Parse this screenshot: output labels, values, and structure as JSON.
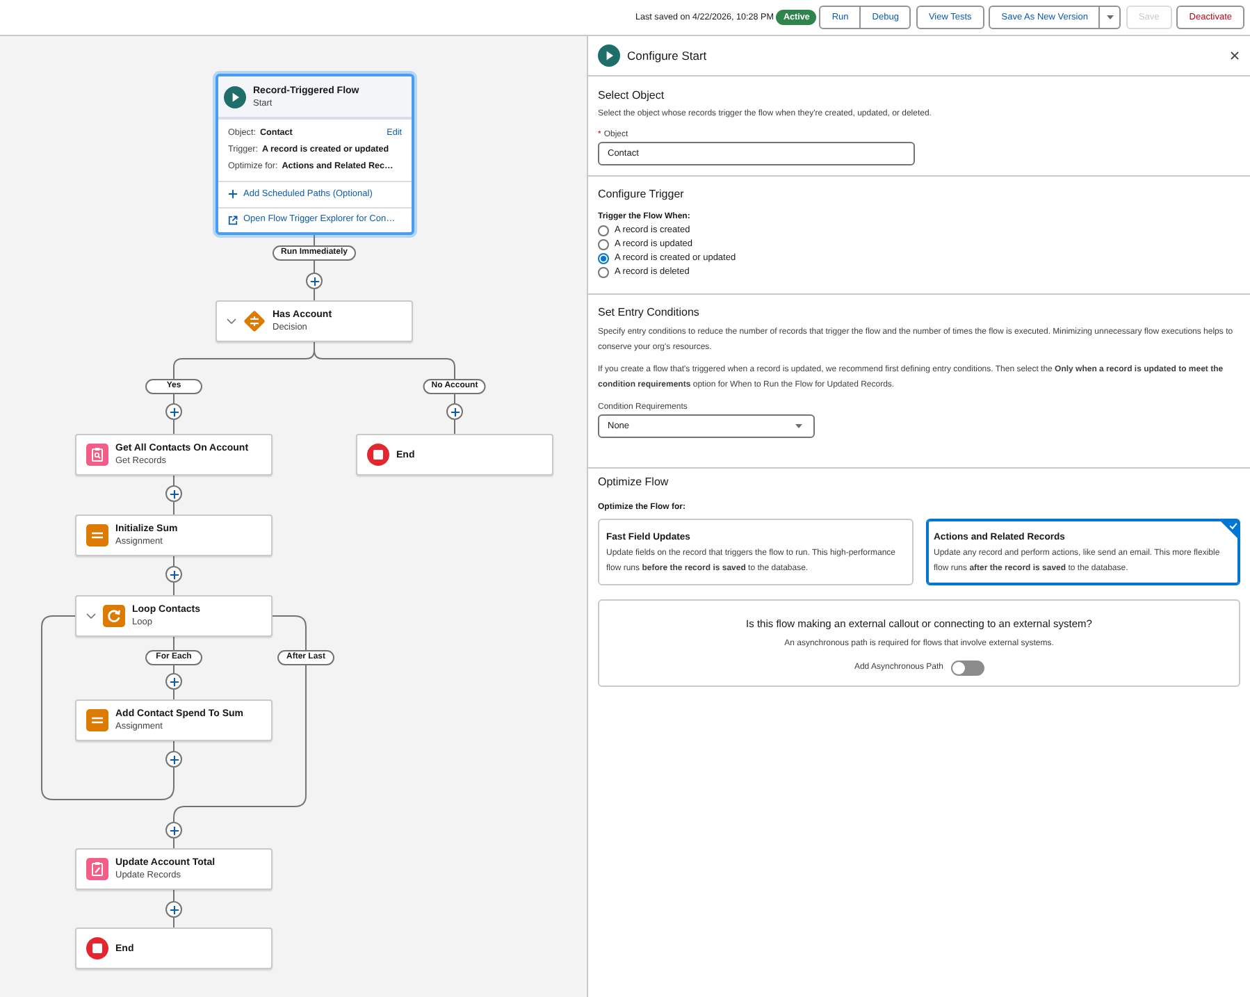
{
  "toolbar": {
    "last_saved": "Last saved on 4/22/2026, 10:28 PM",
    "status": "Active",
    "button_groups": [
      [
        {
          "kind": "neutral",
          "label": "Run",
          "disabled": false
        },
        {
          "kind": "neutral",
          "label": "Debug",
          "disabled": false
        }
      ],
      [
        {
          "kind": "neutral",
          "label": "View Tests",
          "disabled": false
        }
      ],
      [
        {
          "kind": "neutral",
          "label": "Save As New Version",
          "disabled": false
        },
        {
          "kind": "menu",
          "disabled": false
        }
      ],
      [
        {
          "kind": "neutral",
          "label": "Save",
          "disabled": true
        }
      ],
      [
        {
          "kind": "destructive",
          "label": "Deactivate",
          "disabled": false
        }
      ]
    ]
  },
  "canvas": {
    "start_node": {
      "title": "Record-Triggered Flow",
      "subtitle": "Start",
      "selected": true,
      "details": [
        {
          "label": "Object:",
          "value": "Contact",
          "action": "Edit"
        },
        {
          "label": "Trigger:",
          "value": "A record is created or updated"
        },
        {
          "label": "Optimize for:",
          "value": "Actions and Related Rec…"
        }
      ],
      "links": [
        {
          "kind": "add",
          "text": "Add Scheduled Paths (Optional)"
        },
        {
          "kind": "external",
          "text": "Open Flow Trigger Explorer for Con…"
        }
      ]
    },
    "connector_labels": [
      "Run Immediately",
      "Yes",
      "No Account",
      "For Each",
      "After Last"
    ],
    "nodes": [
      {
        "kind": "decision",
        "title": "Has Account",
        "subtitle": "Decision",
        "selected": false
      },
      {
        "kind": "get_records",
        "title": "Get All Contacts On Account",
        "subtitle": "Get Records",
        "selected": false
      },
      {
        "kind": "end",
        "title": "End",
        "selected": false
      },
      {
        "kind": "assignment",
        "title": "Initialize Sum",
        "subtitle": "Assignment",
        "selected": false
      },
      {
        "kind": "loop",
        "title": "Loop Contacts",
        "subtitle": "Loop",
        "selected": false
      },
      {
        "kind": "assignment",
        "title": "Add Contact Spend To Sum",
        "subtitle": "Assignment",
        "selected": false
      },
      {
        "kind": "update_records",
        "title": "Update Account Total",
        "subtitle": "Update Records",
        "selected": false
      },
      {
        "kind": "end",
        "title": "End",
        "selected": false
      }
    ]
  },
  "panel": {
    "title": "Configure Start",
    "select_object": {
      "heading": "Select Object",
      "description": "Select the object whose records trigger the flow when they're created, updated, or deleted.",
      "required_mark": "*",
      "field_label": "Object",
      "value": "Contact"
    },
    "configure_trigger": {
      "heading": "Configure Trigger",
      "group_label": "Trigger the Flow When:",
      "options": [
        {
          "label": "A record is created",
          "selected": false
        },
        {
          "label": "A record is updated",
          "selected": false
        },
        {
          "label": "A record is created or updated",
          "selected": true
        },
        {
          "label": "A record is deleted",
          "selected": false
        }
      ]
    },
    "entry_conditions": {
      "heading": "Set Entry Conditions",
      "paragraphs": [
        "Specify entry conditions to reduce the number of records that trigger the flow and the number of times the flow is executed. Minimizing unnecessary flow executions helps to conserve your org's resources.",
        "If you create a flow that's triggered when a record is updated, we recommend first defining entry conditions. Then select the **Only when a record is updated to meet the condition requirements** option for When to Run the Flow for Updated Records."
      ],
      "select_label": "Condition Requirements",
      "select_value": "None"
    },
    "optimize": {
      "heading": "Optimize Flow",
      "group_label": "Optimize the Flow for:",
      "options": [
        {
          "title": "Fast Field Updates",
          "description": "Update fields on the record that triggers the flow to run. This high-performance flow runs **before the record is saved** to the database.",
          "selected": false
        },
        {
          "title": "Actions and Related Records",
          "description": "Update any record and perform actions, like send an email. This more flexible flow runs **after the record is saved** to the database.",
          "selected": true
        }
      ],
      "async_box": {
        "question": "Is this flow making an external callout or connecting to an external system?",
        "note": "An asynchronous path is required for flows that involve external systems.",
        "toggle_label": "Add Asynchronous Path",
        "on": false
      }
    }
  }
}
